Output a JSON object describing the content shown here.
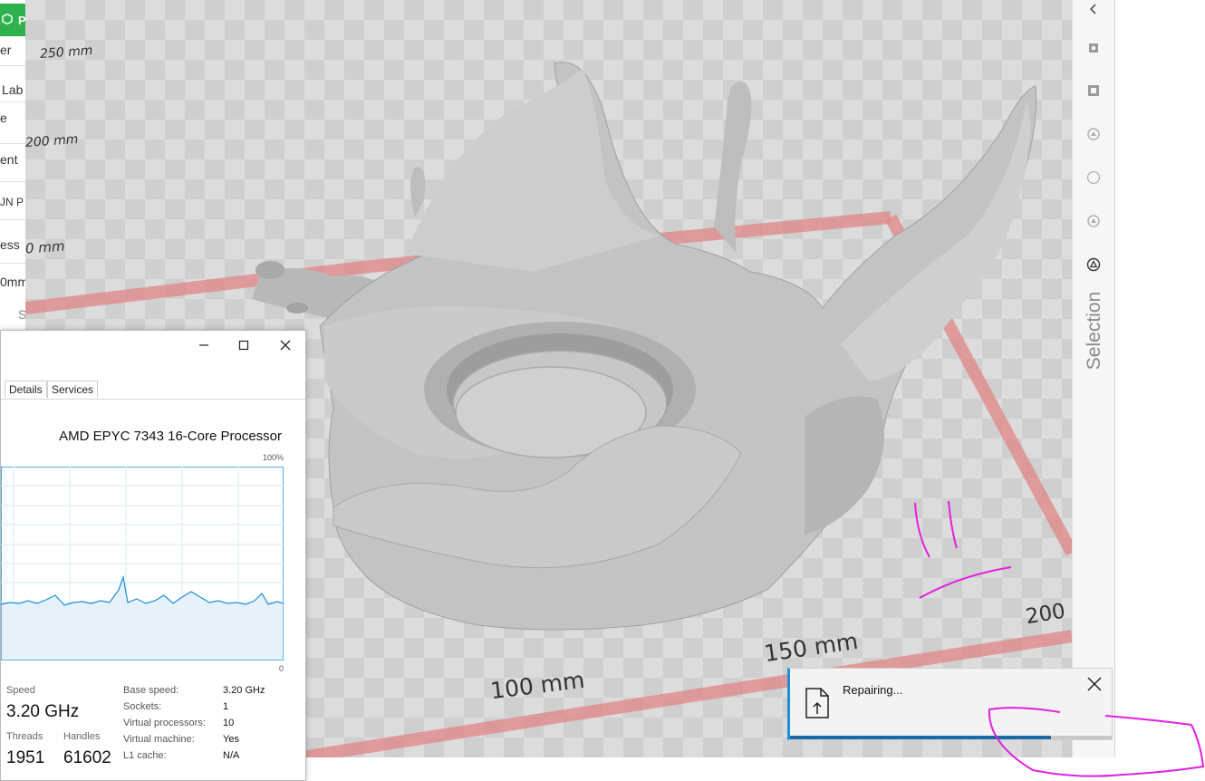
{
  "left_strip": {
    "brand_letter": "P",
    "items": [
      "er",
      "Lab",
      "e",
      "ent",
      "JN P",
      "ess",
      "0mm",
      "S"
    ]
  },
  "viewport": {
    "axis_labels": [
      "250 mm",
      "200 mm",
      "0 mm",
      "100 mm",
      "150 mm",
      "200"
    ]
  },
  "right_toolbar": {
    "icons": [
      "chevron-left-icon",
      "move-icon",
      "scale-icon",
      "rotate-icon",
      "circle-icon",
      "mirror-icon",
      "support-icon"
    ],
    "selection_label": "Selection"
  },
  "task_manager": {
    "window_controls": [
      "minimize-icon",
      "maximize-icon",
      "close-icon"
    ],
    "tabs": [
      "Details",
      "Services"
    ],
    "cpu_name": "AMD EPYC 7343 16-Core Processor",
    "graph_top_label": "100%",
    "graph_bottom_label": "0",
    "speed_label": "Speed",
    "speed_value": "3.20 GHz",
    "threads_label": "Threads",
    "threads_value": "1951",
    "handles_label": "Handles",
    "handles_value": "61602",
    "specs": [
      {
        "k": "Base speed:",
        "v": "3.20 GHz"
      },
      {
        "k": "Sockets:",
        "v": "1"
      },
      {
        "k": "Virtual processors:",
        "v": "10"
      },
      {
        "k": "Virtual machine:",
        "v": "Yes"
      },
      {
        "k": "L1 cache:",
        "v": "N/A"
      }
    ],
    "accent": "#1e8fd6"
  },
  "notification": {
    "text": "Repairing...",
    "progress": 0.81,
    "accent": "#1e8fd6"
  }
}
